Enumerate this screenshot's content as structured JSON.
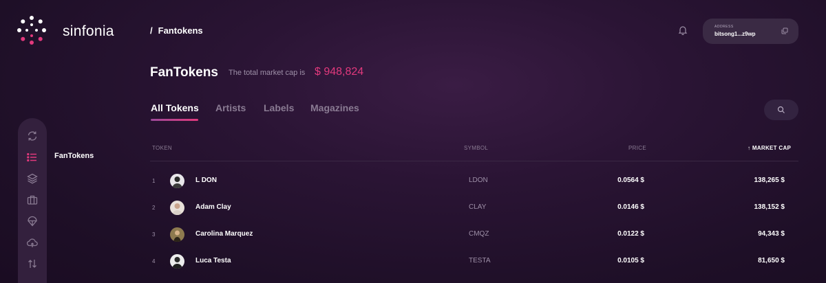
{
  "brand": {
    "name": "sinfonia"
  },
  "breadcrumb": {
    "separator": "/",
    "current": "Fantokens"
  },
  "wallet": {
    "label": "ADDRESS",
    "value": "bitsong1...z9wp"
  },
  "sidebar": {
    "label": "FanTokens",
    "icons": [
      "refresh-icon",
      "list-icon",
      "layers-icon",
      "briefcase-icon",
      "balloon-icon",
      "cloud-upload-icon",
      "swap-icon"
    ],
    "active_icon": "list-icon"
  },
  "page": {
    "title": "FanTokens",
    "market_cap_label": "The total market cap is",
    "market_cap_value": "$ 948,824"
  },
  "tabs": [
    {
      "label": "All Tokens",
      "active": true
    },
    {
      "label": "Artists",
      "active": false
    },
    {
      "label": "Labels",
      "active": false
    },
    {
      "label": "Magazines",
      "active": false
    }
  ],
  "table": {
    "columns": {
      "token": "TOKEN",
      "symbol": "SYMBOL",
      "price": "PRICE",
      "market_cap": "MARKET CAP"
    },
    "sort_indicator": "↑",
    "rows": [
      {
        "index": "1",
        "name": "L DON",
        "symbol": "LDON",
        "price": "0.0564 $",
        "market_cap": "138,265 $"
      },
      {
        "index": "2",
        "name": "Adam Clay",
        "symbol": "CLAY",
        "price": "0.0146 $",
        "market_cap": "138,152 $"
      },
      {
        "index": "3",
        "name": "Carolina Marquez",
        "symbol": "CMQZ",
        "price": "0.0122 $",
        "market_cap": "94,343 $"
      },
      {
        "index": "4",
        "name": "Luca Testa",
        "symbol": "TESTA",
        "price": "0.0105 $",
        "market_cap": "81,650 $"
      }
    ]
  },
  "colors": {
    "accent": "#e2397d",
    "background": "#1e0f27",
    "muted": "#8a7b93"
  }
}
